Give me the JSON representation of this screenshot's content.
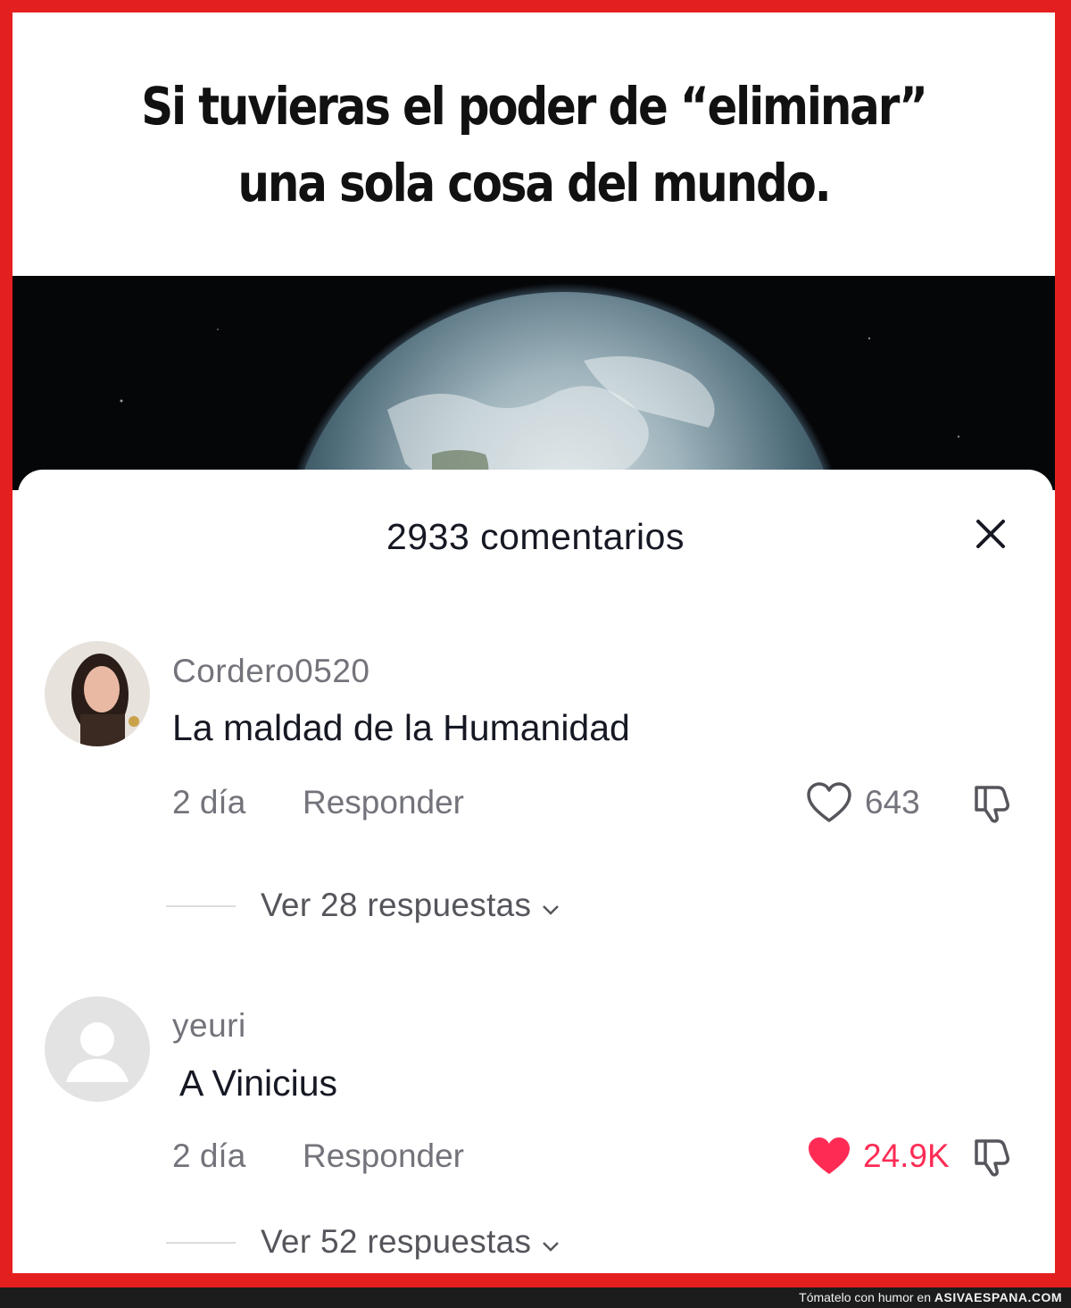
{
  "headline": {
    "line1": "Si tuvieras el poder de “eliminar”",
    "line2": "una sola cosa del mundo."
  },
  "comments_sheet": {
    "title": "2933 comentarios",
    "close_icon": "close-icon"
  },
  "comments": [
    {
      "username": "Cordero0520",
      "text": "La maldad de la Humanidad",
      "time": "2 día",
      "reply_label": "Responder",
      "likes": "643",
      "liked": false,
      "view_replies": "Ver 28 respuestas"
    },
    {
      "username": "yeuri",
      "text": "A Vinicius",
      "time": "2 día",
      "reply_label": "Responder",
      "likes": "24.9K",
      "liked": true,
      "view_replies": "Ver 52 respuestas"
    }
  ],
  "footer": {
    "tagline": "Tómatelo con humor en ",
    "site": "ASIVAESPANA.COM"
  },
  "colors": {
    "border": "#e41f1f",
    "liked_heart": "#fe2c55",
    "text_primary": "#161823",
    "text_secondary": "#73747b"
  }
}
